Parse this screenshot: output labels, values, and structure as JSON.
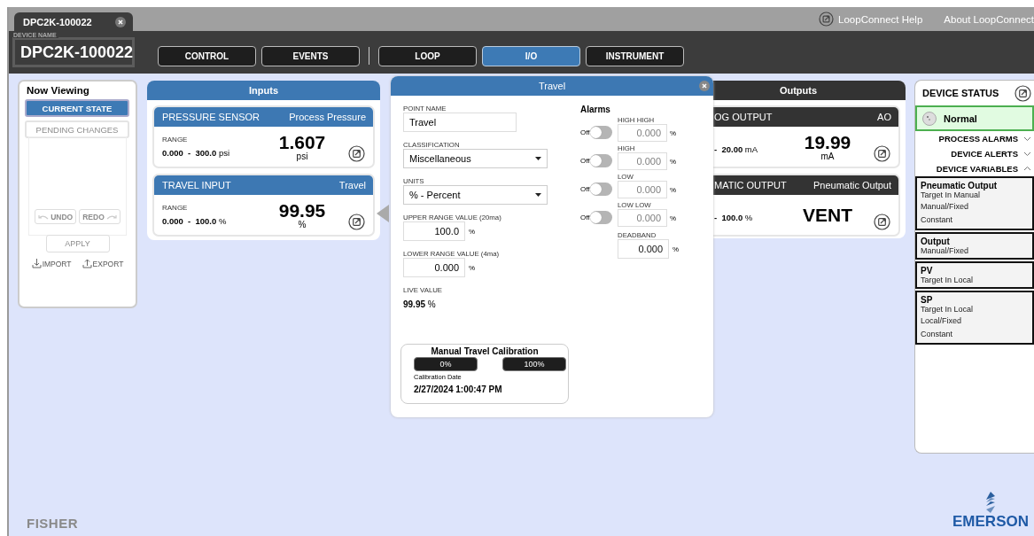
{
  "tabs": [
    {
      "label": "DPC2K-100022",
      "selected": true
    }
  ],
  "help_links": [
    "LoopConnect Help",
    "About LoopConnect"
  ],
  "device_name": {
    "label": "DEVICE NAME",
    "value": "DPC2K-100022"
  },
  "nav": [
    {
      "label": "CONTROL",
      "selected": false
    },
    {
      "label": "EVENTS",
      "selected": false
    },
    {
      "label": "LOOP",
      "selected": false
    },
    {
      "label": "I/O",
      "selected": true
    },
    {
      "label": "INSTRUMENT",
      "selected": false
    }
  ],
  "now_viewing": {
    "title": "Now Viewing",
    "views": [
      {
        "label": "CURRENT STATE",
        "selected": true,
        "disabled": false
      },
      {
        "label": "PENDING CHANGES",
        "selected": false,
        "disabled": true
      }
    ],
    "undo": {
      "label": "UNDO",
      "disabled": true
    },
    "redo": {
      "label": "REDO",
      "disabled": true
    },
    "apply": {
      "label": "APPLY",
      "disabled": true
    },
    "import": "IMPORT",
    "export": "EXPORT"
  },
  "inputs": {
    "title": "Inputs",
    "cards": [
      {
        "name": "PRESSURE SENSOR",
        "tag": "Process Pressure",
        "range_label": "RANGE",
        "range_low": "0.000",
        "range_sep": "-",
        "range_high": "300.0",
        "range_unit": "psi",
        "value": "1.607",
        "unit": "psi"
      },
      {
        "name": "TRAVEL INPUT",
        "tag": "Travel",
        "range_label": "RANGE",
        "range_low": "0.000",
        "range_sep": "-",
        "range_high": "100.0",
        "range_unit": "%",
        "value": "99.95",
        "unit": "%"
      }
    ]
  },
  "outputs": {
    "title": "Outputs",
    "cards": [
      {
        "name": "OG OUTPUT",
        "tag": "AO",
        "range_sep": "-",
        "range_high": "20.00",
        "range_unit": "mA",
        "value": "19.99",
        "unit": "mA"
      },
      {
        "name": "MATIC OUTPUT",
        "tag": "Pneumatic Output",
        "range_sep": "-",
        "range_high": "100.0",
        "range_unit": "%",
        "value": "VENT"
      }
    ]
  },
  "popup": {
    "title": "Travel",
    "fields": [
      {
        "kind": "text",
        "label": "POINT NAME",
        "value": "Travel"
      },
      {
        "kind": "select",
        "label": "CLASSIFICATION",
        "value": "Miscellaneous"
      },
      {
        "kind": "select",
        "label": "UNITS",
        "value": "% - Percent"
      },
      {
        "kind": "number",
        "label": "UPPER RANGE VALUE (20ma)",
        "value": "100.0",
        "unit": "%"
      },
      {
        "kind": "number",
        "label": "LOWER RANGE VALUE (4ma)",
        "value": "0.000",
        "unit": "%"
      },
      {
        "kind": "readout",
        "label": "LIVE VALUE",
        "value": "99.95",
        "unit": "%"
      }
    ],
    "alarms": {
      "title": "Alarms",
      "items": [
        {
          "label": "HIGH HIGH",
          "toggle_label": "Off",
          "on": false,
          "value": "0.000",
          "unit": "%",
          "disabled": true
        },
        {
          "label": "HIGH",
          "toggle_label": "Off",
          "on": false,
          "value": "0.000",
          "unit": "%",
          "disabled": true
        },
        {
          "label": "LOW",
          "toggle_label": "Off",
          "on": false,
          "value": "0.000",
          "unit": "%",
          "disabled": true
        },
        {
          "label": "LOW LOW",
          "toggle_label": "Off",
          "on": false,
          "value": "0.000",
          "unit": "%",
          "disabled": true
        }
      ],
      "deadband": {
        "label": "DEADBAND",
        "value": "0.000",
        "unit": "%"
      }
    },
    "calibration": {
      "title": "Manual Travel Calibration",
      "buttons": [
        "0%",
        "100%"
      ],
      "date_label": "Calibration Date",
      "date": "2/27/2024 1:00:47 PM"
    }
  },
  "status": {
    "title": "DEVICE STATUS",
    "state": "Normal",
    "sections": [
      {
        "label": "PROCESS ALARMS",
        "expanded": false
      },
      {
        "label": "DEVICE ALERTS",
        "expanded": false
      },
      {
        "label": "DEVICE VARIABLES",
        "expanded": true
      }
    ],
    "variables": [
      {
        "name": "Pneumatic Output",
        "lines": [
          "Target In Manual",
          "Manual/Fixed",
          "Constant"
        ]
      },
      {
        "name": "Output",
        "lines": [
          "Manual/Fixed"
        ]
      },
      {
        "name": "PV",
        "lines": [
          "Target In Local"
        ]
      },
      {
        "name": "SP",
        "lines": [
          "Target In Local",
          "Local/Fixed",
          "Constant"
        ]
      }
    ]
  },
  "footer": {
    "left_brand": "FISHER",
    "right_brand": "EMERSON"
  }
}
